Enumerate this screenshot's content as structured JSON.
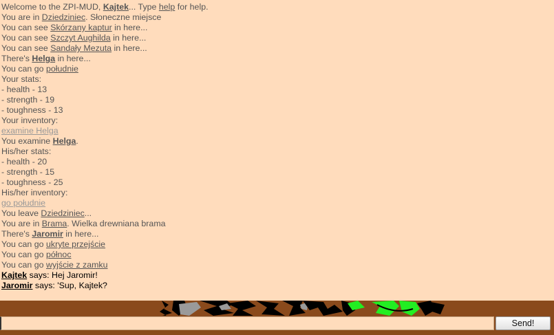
{
  "log": [
    {
      "parts": [
        {
          "t": "Welcome to the ZPI-MUD, "
        },
        {
          "t": "Kajtek",
          "s": "ent"
        },
        {
          "t": "... Type "
        },
        {
          "t": "help",
          "s": "lnk"
        },
        {
          "t": " for help."
        }
      ]
    },
    {
      "parts": [
        {
          "t": "You are in "
        },
        {
          "t": "Dziedziniec",
          "s": "lnk"
        },
        {
          "t": ". Słoneczne miejsce"
        }
      ]
    },
    {
      "parts": [
        {
          "t": "You can see "
        },
        {
          "t": "Skórzany kaptur",
          "s": "lnk"
        },
        {
          "t": " in here..."
        }
      ]
    },
    {
      "parts": [
        {
          "t": "You can see "
        },
        {
          "t": "Szczyt Aughilda",
          "s": "lnk"
        },
        {
          "t": " in here..."
        }
      ]
    },
    {
      "parts": [
        {
          "t": "You can see "
        },
        {
          "t": "Sandały Mezuta",
          "s": "lnk"
        },
        {
          "t": " in here..."
        }
      ]
    },
    {
      "parts": [
        {
          "t": "There's "
        },
        {
          "t": "Helga",
          "s": "ent"
        },
        {
          "t": " in here..."
        }
      ]
    },
    {
      "parts": [
        {
          "t": "You can go "
        },
        {
          "t": "południe",
          "s": "lnk"
        }
      ]
    },
    {
      "parts": [
        {
          "t": "Your stats:"
        }
      ]
    },
    {
      "parts": [
        {
          "t": "- health - 13"
        }
      ]
    },
    {
      "parts": [
        {
          "t": "- strength - 19"
        }
      ]
    },
    {
      "parts": [
        {
          "t": "- toughness - 13"
        }
      ]
    },
    {
      "parts": [
        {
          "t": "Your inventory:"
        }
      ]
    },
    {
      "parts": [
        {
          "t": "examine Helga",
          "s": "cmd"
        }
      ]
    },
    {
      "parts": [
        {
          "t": "You examine "
        },
        {
          "t": "Helga",
          "s": "ent"
        },
        {
          "t": "."
        }
      ]
    },
    {
      "parts": [
        {
          "t": "His/her stats:"
        }
      ]
    },
    {
      "parts": [
        {
          "t": "- health - 20"
        }
      ]
    },
    {
      "parts": [
        {
          "t": "- strength - 15"
        }
      ]
    },
    {
      "parts": [
        {
          "t": "- toughness - 25"
        }
      ]
    },
    {
      "parts": [
        {
          "t": "His/her inventory:"
        }
      ]
    },
    {
      "parts": [
        {
          "t": "go południe",
          "s": "cmd"
        }
      ]
    },
    {
      "parts": [
        {
          "t": "You leave "
        },
        {
          "t": "Dziedziniec",
          "s": "lnk"
        },
        {
          "t": "..."
        }
      ]
    },
    {
      "parts": [
        {
          "t": "You are in "
        },
        {
          "t": "Brama",
          "s": "lnk"
        },
        {
          "t": ". Wielka drewniana brama"
        }
      ]
    },
    {
      "parts": [
        {
          "t": "There's "
        },
        {
          "t": "Jaromir",
          "s": "ent"
        },
        {
          "t": " in here..."
        }
      ]
    },
    {
      "parts": [
        {
          "t": "You can go "
        },
        {
          "t": "ukryte przejście",
          "s": "lnk"
        }
      ]
    },
    {
      "parts": [
        {
          "t": "You can go "
        },
        {
          "t": "północ",
          "s": "lnk"
        }
      ]
    },
    {
      "parts": [
        {
          "t": "You can go "
        },
        {
          "t": "wyjście z zamku",
          "s": "lnk"
        }
      ]
    },
    {
      "parts": [
        {
          "t": "Kajtek",
          "s": "spk"
        },
        {
          "t": " says: Hej Jaromir!",
          "s": "said"
        }
      ]
    },
    {
      "parts": [
        {
          "t": "Jaromir",
          "s": "spk"
        },
        {
          "t": " says: 'Sup, Kajtek?",
          "s": "said"
        }
      ]
    }
  ],
  "input": {
    "value": "",
    "placeholder": ""
  },
  "send_label": "Send!",
  "colors": {
    "log_bg": "#ffdcbc",
    "scene_brown": "#8a4a1c",
    "scene_green": "#22ee22"
  }
}
